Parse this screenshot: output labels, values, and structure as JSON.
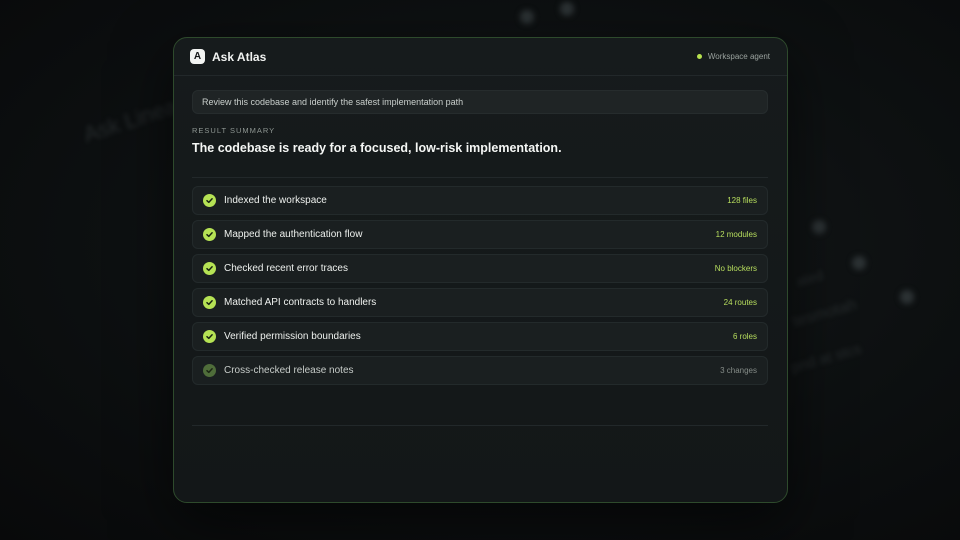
{
  "background": {
    "ghost_left": "Ask Linea",
    "ghost_r1": "ated",
    "ghost_r2": "tesmotah",
    "ghost_r3": "pnd at stcs"
  },
  "header": {
    "logo_letter": "A",
    "title": "Ask Atlas",
    "agent_label": "Workspace agent",
    "agent_dot_color": "#b7e24f"
  },
  "prompt": {
    "text": "Review this codebase and identify the safest implementation path"
  },
  "summary": {
    "label": "RESULT SUMMARY",
    "title": "The codebase is ready for a focused, low-risk implementation."
  },
  "steps": [
    {
      "label": "Indexed the workspace",
      "meta": "128 files",
      "status": "done"
    },
    {
      "label": "Mapped the authentication flow",
      "meta": "12 modules",
      "status": "done"
    },
    {
      "label": "Checked recent error traces",
      "meta": "No blockers",
      "status": "done"
    },
    {
      "label": "Matched API contracts to handlers",
      "meta": "24 routes",
      "status": "done"
    },
    {
      "label": "Verified permission boundaries",
      "meta": "6 roles",
      "status": "done"
    },
    {
      "label": "Cross-checked release notes",
      "meta": "3 changes",
      "status": "in-progress"
    }
  ],
  "colors": {
    "accent": "#b5e254",
    "card_border": "#2e4a2c"
  }
}
